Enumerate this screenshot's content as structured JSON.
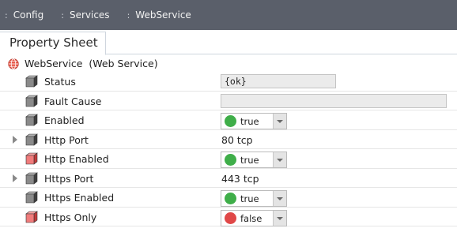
{
  "breadcrumb": [
    {
      "label": "Config"
    },
    {
      "label": "Services"
    },
    {
      "label": "WebService"
    }
  ],
  "breadcrumb_sep": ":",
  "tab": {
    "label": "Property Sheet"
  },
  "root": {
    "name": "WebService",
    "type": "(Web Service)",
    "icon": "globe-icon"
  },
  "properties": [
    {
      "name": "Status",
      "kind": "field",
      "value": "{ok}",
      "cube": "gray",
      "expandable": false
    },
    {
      "name": "Fault Cause",
      "kind": "field",
      "value": "",
      "cube": "gray",
      "expandable": false
    },
    {
      "name": "Enabled",
      "kind": "select",
      "value": "true",
      "status": "green",
      "cube": "gray",
      "expandable": false
    },
    {
      "name": "Http Port",
      "kind": "text",
      "value": "80 tcp",
      "cube": "gray",
      "expandable": true
    },
    {
      "name": "Http Enabled",
      "kind": "select",
      "value": "true",
      "status": "green",
      "cube": "red",
      "expandable": false
    },
    {
      "name": "Https Port",
      "kind": "text",
      "value": "443 tcp",
      "cube": "gray",
      "expandable": true
    },
    {
      "name": "Https Enabled",
      "kind": "select",
      "value": "true",
      "status": "green",
      "cube": "gray",
      "expandable": false
    },
    {
      "name": "Https Only",
      "kind": "select",
      "value": "false",
      "status": "red",
      "cube": "red",
      "expandable": false
    }
  ],
  "colors": {
    "topbar": "#5a5f6a",
    "green": "#3fae49",
    "red": "#e04848",
    "cube_gray": "#5c5c5c",
    "cube_red": "#e25555"
  }
}
